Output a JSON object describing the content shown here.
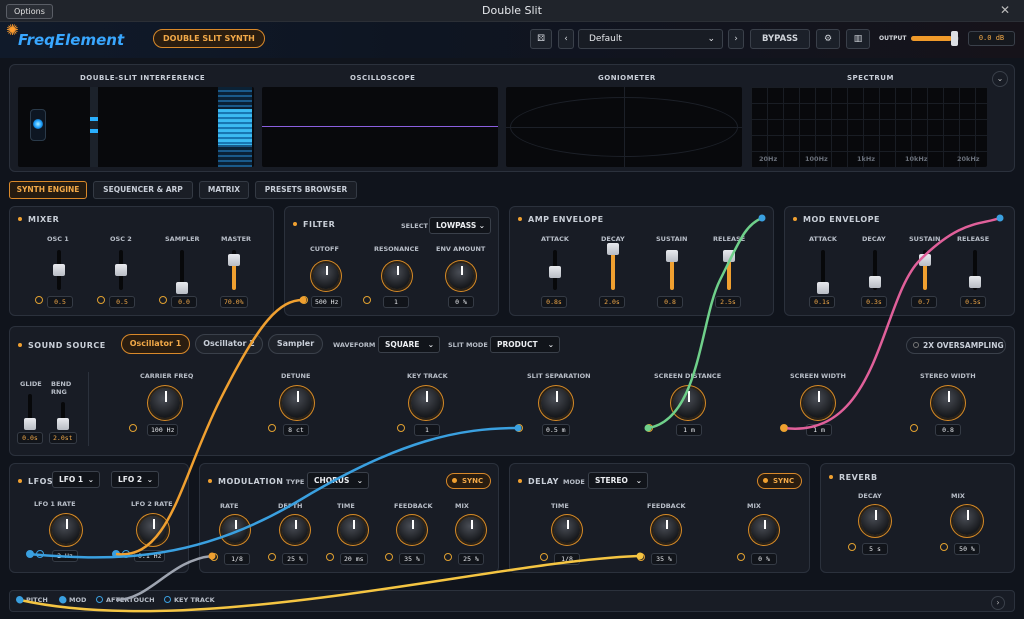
{
  "window": {
    "title": "Double Slit",
    "options": "Options",
    "close": "✕"
  },
  "header": {
    "logo": "FreqElement",
    "product": "DOUBLE SLIT SYNTH",
    "preset": "Default",
    "bypass": "BYPASS",
    "output_label": "OUTPUT",
    "output_value": "0.0 dB",
    "prev": "‹",
    "next": "›",
    "caret": "⌄"
  },
  "visuals": {
    "interference": "DOUBLE-SLIT INTERFERENCE",
    "oscilloscope": "OSCILLOSCOPE",
    "goniometer": "GONIOMETER",
    "spectrum": "SPECTRUM",
    "freq_labels": [
      "20Hz",
      "100Hz",
      "1kHz",
      "10kHz",
      "20kHz"
    ]
  },
  "tabs": [
    "SYNTH ENGINE",
    "SEQUENCER & ARP",
    "MATRIX",
    "PRESETS BROWSER"
  ],
  "mixer": {
    "title": "MIXER",
    "channels": [
      {
        "label": "OSC 1",
        "value": "0.5"
      },
      {
        "label": "OSC 2",
        "value": "0.5"
      },
      {
        "label": "SAMPLER",
        "value": "0.0"
      },
      {
        "label": "MASTER",
        "value": "70.0%"
      }
    ]
  },
  "filter": {
    "title": "FILTER",
    "select_label": "SELECT",
    "mode": "LOWPASS",
    "knobs": [
      {
        "label": "CUTOFF",
        "value": "500 Hz"
      },
      {
        "label": "RESONANCE",
        "value": "1"
      },
      {
        "label": "ENV AMOUNT",
        "value": "0 %"
      }
    ]
  },
  "amp": {
    "title": "AMP ENVELOPE",
    "params": [
      {
        "label": "ATTACK",
        "value": "0.8s"
      },
      {
        "label": "DECAY",
        "value": "2.0s"
      },
      {
        "label": "SUSTAIN",
        "value": "0.8"
      },
      {
        "label": "RELEASE",
        "value": "2.5s"
      }
    ]
  },
  "modenv": {
    "title": "MOD ENVELOPE",
    "params": [
      {
        "label": "ATTACK",
        "value": "0.1s"
      },
      {
        "label": "DECAY",
        "value": "0.3s"
      },
      {
        "label": "SUSTAIN",
        "value": "0.7"
      },
      {
        "label": "RELEASE",
        "value": "0.5s"
      }
    ]
  },
  "source": {
    "title": "SOUND SOURCE",
    "tabs": [
      "Oscillator 1",
      "Oscillator 2",
      "Sampler"
    ],
    "waveform_label": "WAVEFORM",
    "waveform": "SQUARE",
    "slit_label": "SLIT MODE",
    "slit": "PRODUCT",
    "oversampling": "2X OVERSAMPLING",
    "glide": "GLIDE",
    "bend": "BEND RNG",
    "glide_val": "0.0s",
    "bend_val": "2.0st",
    "knobs": [
      {
        "label": "CARRIER FREQ",
        "value": "100 Hz"
      },
      {
        "label": "DETUNE",
        "value": "8 ct"
      },
      {
        "label": "KEY TRACK",
        "value": "1"
      },
      {
        "label": "SLIT SEPARATION",
        "value": "0.5 m"
      },
      {
        "label": "SCREEN DISTANCE",
        "value": "1 m"
      },
      {
        "label": "SCREEN WIDTH",
        "value": "1 m"
      },
      {
        "label": "STEREO WIDTH",
        "value": "0.8"
      }
    ]
  },
  "lfos": {
    "title": "LFOS",
    "lfo1": "LFO 1",
    "lfo2": "LFO 2",
    "knobs": [
      {
        "label": "LFO 1 RATE",
        "value": "2 Hz"
      },
      {
        "label": "LFO 2 RATE",
        "value": "0.1 Hz"
      }
    ]
  },
  "modulation": {
    "title": "MODULATION",
    "type_label": "TYPE",
    "type": "CHORUS",
    "sync": "SYNC",
    "knobs": [
      {
        "label": "RATE",
        "value": "1/8"
      },
      {
        "label": "DEPTH",
        "value": "25 %"
      },
      {
        "label": "TIME",
        "value": "20 ms"
      },
      {
        "label": "FEEDBACK",
        "value": "35 %"
      },
      {
        "label": "MIX",
        "value": "25 %"
      }
    ]
  },
  "delay": {
    "title": "DELAY",
    "mode_label": "MODE",
    "mode": "STEREO",
    "sync": "SYNC",
    "knobs": [
      {
        "label": "TIME",
        "value": "1/8"
      },
      {
        "label": "FEEDBACK",
        "value": "35 %"
      },
      {
        "label": "MIX",
        "value": "0 %"
      }
    ]
  },
  "reverb": {
    "title": "REVERB",
    "knobs": [
      {
        "label": "DECAY",
        "value": "5 s"
      },
      {
        "label": "MIX",
        "value": "50 %"
      }
    ]
  },
  "mod_sources": [
    "PITCH",
    "MOD",
    "AFTERTOUCH",
    "KEY TRACK"
  ],
  "colors": {
    "accent": "#f0a030",
    "blue": "#39a7ff",
    "cable_orange": "#f0a030",
    "cable_blue": "#3aa0e0",
    "cable_green": "#6fd08a",
    "cable_pink": "#e0609a",
    "cable_yellow": "#f5c542",
    "cable_gray": "#9ea4b0"
  }
}
